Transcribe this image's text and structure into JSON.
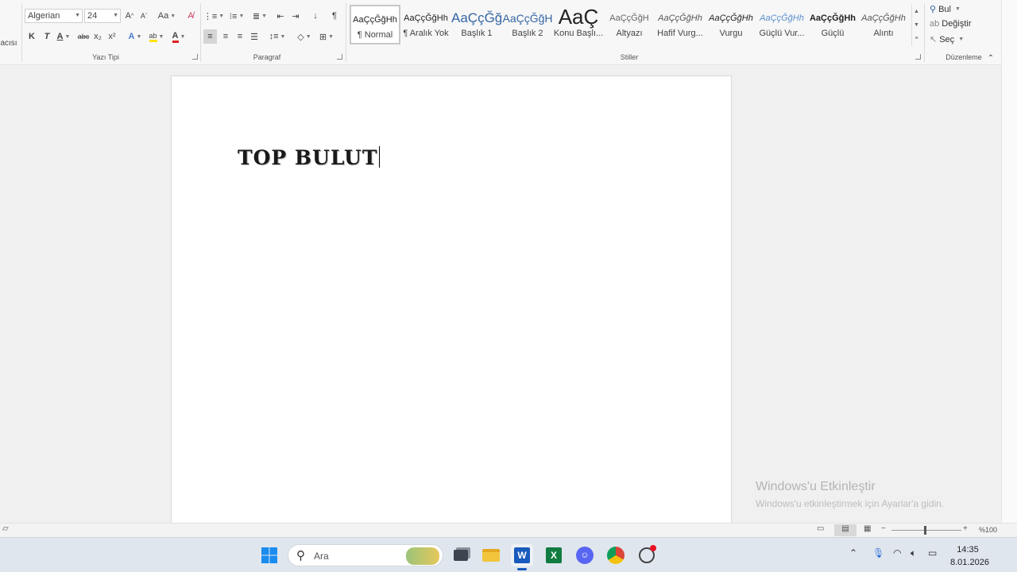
{
  "ribbon": {
    "clipboard_label_partial": "acısı",
    "font": {
      "name": "Algerian",
      "size": "24",
      "grow_label": "A",
      "shrink_label": "A",
      "case_label": "Aa",
      "bold": "K",
      "italic": "T",
      "underline": "A",
      "strike": "abc",
      "sub": "x₂",
      "sup": "x²",
      "effects": "A",
      "highlight": "ab",
      "color": "A",
      "group_label": "Yazı Tipi"
    },
    "paragraph": {
      "group_label": "Paragraf",
      "pilcrow": "¶"
    },
    "styles": {
      "group_label": "Stiller",
      "items": [
        {
          "preview": "AaÇçĞğHh",
          "name": "¶ Normal"
        },
        {
          "preview": "AaÇçĞğHh",
          "name": "¶ Aralık Yok"
        },
        {
          "preview": "AaÇçĞğ",
          "name": "Başlık 1"
        },
        {
          "preview": "AaÇçĞğH",
          "name": "Başlık 2"
        },
        {
          "preview": "AaÇ",
          "name": "Konu Başlı..."
        },
        {
          "preview": "AaÇçĞğH",
          "name": "Altyazı"
        },
        {
          "preview": "AaÇçĞğHh",
          "name": "Hafif Vurg..."
        },
        {
          "preview": "AaÇçĞğHh",
          "name": "Vurgu"
        },
        {
          "preview": "AaÇçĞğHh",
          "name": "Güçlü Vur..."
        },
        {
          "preview": "AaÇçĞğHh",
          "name": "Güçlü"
        },
        {
          "preview": "AaÇçĞğHh",
          "name": "Alıntı"
        }
      ]
    },
    "editing": {
      "group_label": "Düzenleme",
      "find": "Bul",
      "replace": "Değiştir",
      "select": "Seç"
    }
  },
  "document": {
    "text": "TOP BULUT"
  },
  "activation": {
    "title": "Windows'u Etkinleştir",
    "subtitle": "Windows'u etkinleştirmek için Ayarlar'a gidin."
  },
  "status": {
    "zoom": "%100"
  },
  "taskbar": {
    "search_placeholder": "Ara",
    "time": "14:35",
    "date": "8.01.2026"
  },
  "colors": {
    "word_blue": "#185abd",
    "excel_green": "#107c41",
    "discord": "#5865f2",
    "font_color_red": "#e02020",
    "highlight_yellow": "#ffe400"
  }
}
